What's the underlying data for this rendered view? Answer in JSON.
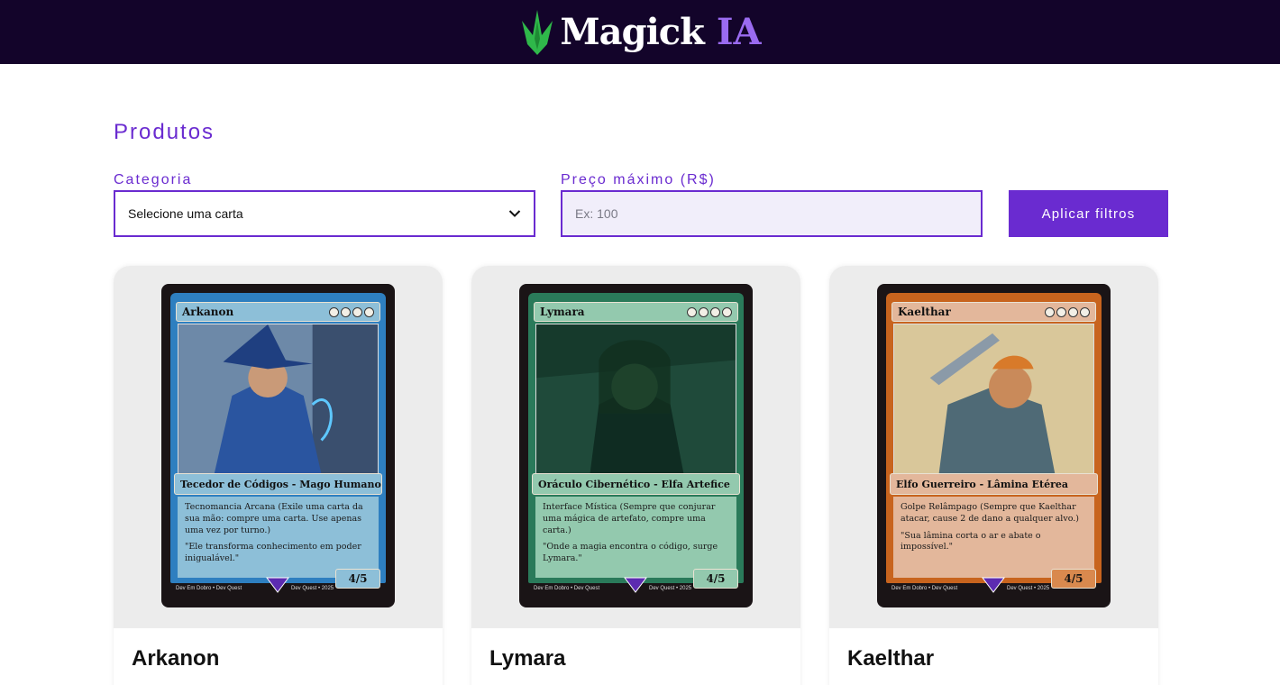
{
  "header": {
    "logo_main": "Magick",
    "logo_accent": "IA"
  },
  "page": {
    "title": "Produtos"
  },
  "filters": {
    "category_label": "Categoria",
    "category_value": "Selecione uma carta",
    "price_label": "Preço máximo (R$)",
    "price_placeholder": "Ex: 100",
    "apply_label": "Aplicar filtros"
  },
  "products": [
    {
      "name": "Arkanon",
      "card": {
        "name": "Arkanon",
        "type": "Tecedor de Códigos - Mago Humano",
        "ability": "Tecnomancia Arcana (Exile uma carta da sua mão: compre uma carta. Use apenas uma vez por turno.)",
        "flavor": "\"Ele transforma conhecimento em poder inigualável.\"",
        "pt": "4/5",
        "footer_left": "Dev Em Dobro • Dev Quest",
        "footer_right": "Dev Quest • 2025",
        "frame_color": "#2e7fc0",
        "box_color": "#8dbfd8",
        "art_color": "#3b5f8c"
      }
    },
    {
      "name": "Lymara",
      "card": {
        "name": "Lymara",
        "type": "Oráculo Cibernético - Elfa Artefice",
        "ability": "Interface Mística (Sempre que conjurar uma mágica de artefato, compre uma carta.)",
        "flavor": "\"Onde a magia encontra o código, surge Lymara.\"",
        "pt": "4/5",
        "footer_left": "Dev Em Dobro • Dev Quest",
        "footer_right": "Dev Quest • 2025",
        "frame_color": "#2a7a5a",
        "box_color": "#93c9ae",
        "art_color": "#1f4a3a"
      }
    },
    {
      "name": "Kaelthar",
      "card": {
        "name": "Kaelthar",
        "type": "Elfo Guerreiro - Lâmina Etérea",
        "ability": "Golpe Relâmpago (Sempre que Kaelthar atacar, cause 2 de dano a qualquer alvo.)",
        "flavor": "\"Sua lâmina corta o ar e abate o impossível.\"",
        "pt": "4/5",
        "footer_left": "Dev Em Dobro • Dev Quest",
        "footer_right": "Dev Quest • 2025",
        "frame_color": "#c8641e",
        "box_color": "#e3b79b",
        "art_color": "#b8a37a"
      }
    }
  ]
}
